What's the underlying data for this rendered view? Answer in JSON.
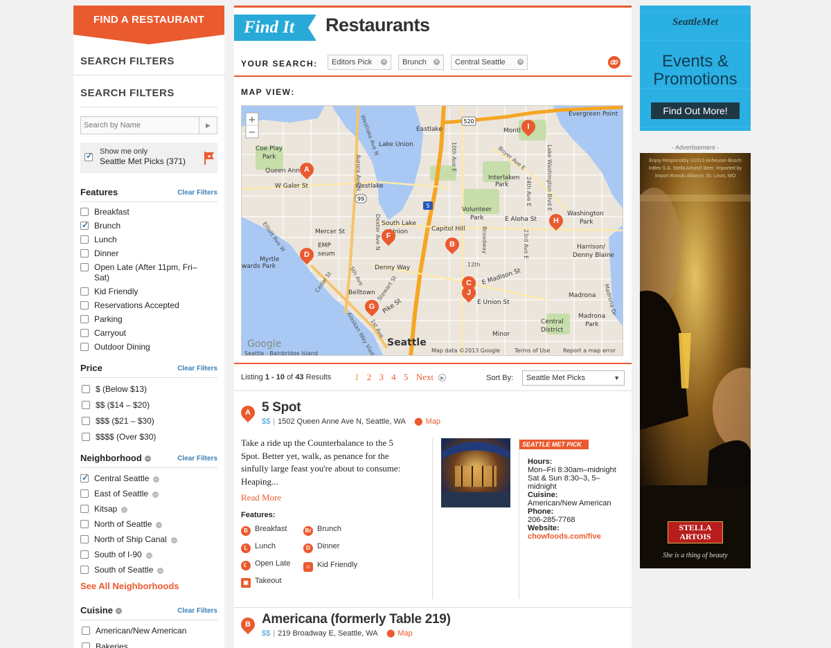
{
  "sidebar": {
    "banner": "FIND A RESTAURANT",
    "search_filters_top": "SEARCH FILTERS",
    "search_filters_title": "SEARCH FILTERS",
    "search_placeholder": "Search by Name",
    "picks_line1": "Show me only",
    "picks_line2": "Seattle Met Picks (371)",
    "clear_label": "Clear Filters",
    "features_title": "Features",
    "features": [
      "Breakfast",
      "Brunch",
      "Lunch",
      "Dinner",
      "Open Late (After 11pm, Fri–Sat)",
      "Kid Friendly",
      "Reservations Accepted",
      "Parking",
      "Carryout",
      "Outdoor Dining"
    ],
    "price_title": "Price",
    "prices": [
      "$ (Below $13)",
      "$$ ($14 – $20)",
      "$$$ ($21 – $30)",
      "$$$$ (Over $30)"
    ],
    "neighborhood_title": "Neighborhood",
    "neighborhoods": [
      "Central Seattle",
      "East of Seattle",
      "Kitsap",
      "North of Seattle",
      "North of Ship Canal",
      "South of I-90",
      "South of Seattle"
    ],
    "see_all": "See All Neighborhoods",
    "cuisine_title": "Cuisine",
    "cuisines": [
      "American/New American",
      "Bakeries"
    ]
  },
  "main": {
    "find_it": "Find It",
    "title": "Restaurants",
    "your_search": "YOUR SEARCH:",
    "chips": [
      "Editors Pick",
      "Brunch",
      "Central Seattle"
    ],
    "map_view": "MAP VIEW:",
    "map_labels": {
      "evergreen": "Evergreen Point",
      "lake_union": "Lake Union",
      "eastlake": "Eastlake",
      "montlake": "Montl",
      "coe_play": "Coe Play",
      "park": "Park",
      "queen_anne": "Queen Ann",
      "w_galer": "W Galer St",
      "westlake": "Westlake",
      "interlaken": "Interlaken",
      "interlaken_park": "Park",
      "volunteer": "Volunteer",
      "volunteer_park": "Park",
      "washington": "Washington",
      "washington_park": "Park",
      "south_lake": "South Lake",
      "union": "Union",
      "capitol_hill": "Capitol Hill",
      "e_aloha": "E Aloha St",
      "mercer": "Mercer St",
      "emp": "EMP",
      "museum": "seum",
      "denny_way": "Denny Way",
      "harrison": "Harrison/",
      "denny_blaine": "Denny Blaine",
      "myrtle": "Myrtle",
      "wards_park": "wards Park",
      "e_madison": "E Madison St",
      "madrona": "Madrona",
      "belltown": "Belltown",
      "e_union": "E Union St",
      "pike": "Pike St",
      "central": "Central",
      "district": "District",
      "madrona_park": "Madrona",
      "madrona_park2": "Park",
      "minor": "Minor",
      "seattle": "Seattle",
      "google": "Google",
      "ferry": "Seattle - Bainbridge Island",
      "mapdata": "Map data ©2013 Google",
      "terms": "Terms of Use",
      "report": "Report a map error",
      "aurora": "Aurora Ave N",
      "westlake_ave": "Westlake Ave N",
      "dexter": "Dexter Ave N",
      "ave_10": "10th Ave E",
      "boyer": "Boyer Ave E",
      "ave_24": "24th Ave E",
      "lake_wa": "Lake Washington Blvd E",
      "ave_23": "23rd Ave E",
      "elliott": "Elliott Ave W",
      "ave_5": "5th Ave",
      "cedar": "Cedar St",
      "stewart": "Stewart St",
      "alaskan": "Alaskan Way Viaduct",
      "ave_1": "1st Ave",
      "ave_12": "12th",
      "broadway": "Broadway",
      "hwy520": "520",
      "hwy99": "99",
      "hwy5": "5"
    },
    "markers": [
      "A",
      "B",
      "D",
      "F",
      "G",
      "C",
      "H",
      "I",
      "J"
    ],
    "listing_pre": "Listing",
    "listing_range": "1 - 10",
    "listing_of": "of",
    "listing_total": "43",
    "listing_post": "Results",
    "pages": [
      "1",
      "2",
      "3",
      "4",
      "5"
    ],
    "next": "Next",
    "sort_by": "Sort By:",
    "sort_value": "Seattle Met Picks"
  },
  "results": [
    {
      "marker": "A",
      "name": "5 Spot",
      "price": "$$",
      "address": "1502 Queen Anne Ave N, Seattle, WA",
      "map_link": "Map",
      "description": "Take a ride up the Counterbalance to the 5 Spot. Better yet, walk, as penance for the sinfully large feast you're about to consume: Heaping...",
      "read_more": "Read More",
      "features_label": "Features:",
      "features": [
        {
          "icon": "B",
          "label": "Breakfast"
        },
        {
          "icon": "Br",
          "label": "Brunch"
        },
        {
          "icon": "L",
          "label": "Lunch"
        },
        {
          "icon": "D",
          "label": "Dinner"
        },
        {
          "icon": "moon",
          "label": "Open Late"
        },
        {
          "icon": "kids",
          "label": "Kid Friendly"
        },
        {
          "icon": "bag",
          "label": "Takeout"
        }
      ],
      "badge": "SEATTLE MET PICK ★",
      "hours_label": "Hours:",
      "hours": "Mon–Fri 8:30am–midnight Sat & Sun 8:30–3, 5–midnight",
      "cuisine_label": "Cuisine:",
      "cuisine": "American/New American",
      "phone_label": "Phone:",
      "phone": "206-285-7768",
      "website_label": "Website:",
      "website": "chowfoods.com/five"
    },
    {
      "marker": "B",
      "name": "Americana (formerly Table 219)",
      "price": "$$",
      "address": "219 Broadway E, Seattle, WA",
      "map_link": "Map"
    }
  ],
  "promo": {
    "logo": "SeattleMet",
    "headline": "Events & Promotions",
    "button": "Find Out More!"
  },
  "ad": {
    "label": "- Advertisement -",
    "fine_print": "Enjoy Responsibly ©2013 Anheuser-Busch InBev S.A. Stella Artois® Beer, Imported by Import Brands Alliance, St. Louis, MO",
    "brand": "STELLA ARTOIS",
    "tagline": "She is a thing of beauty"
  },
  "colors": {
    "accent": "#ea5a2f",
    "blue": "#29a9d8",
    "link": "#3a7fb6"
  }
}
